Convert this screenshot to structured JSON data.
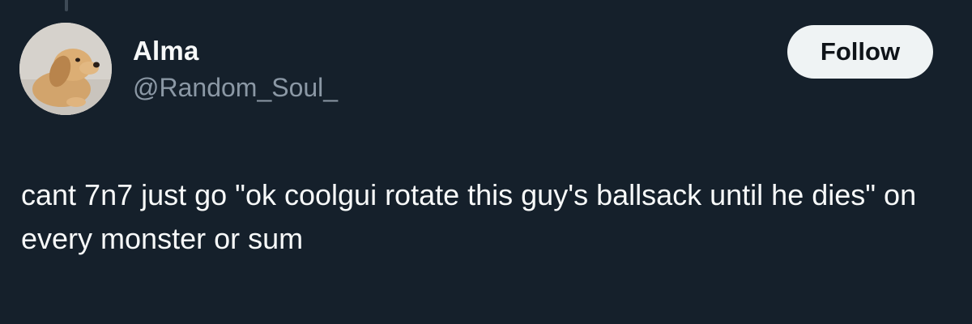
{
  "tweet": {
    "author": {
      "display_name": "Alma",
      "handle": "@Random_Soul_",
      "avatar_icon": "dog-avatar-photo"
    },
    "follow_label": "Follow",
    "text": "cant 7n7 just go \"ok coolgui rotate this guy's ballsack until he dies\" on every monster or sum"
  },
  "colors": {
    "background": "#15202b",
    "primary_text": "#f7f9f9",
    "secondary_text": "#8b98a5",
    "follow_button_bg": "#eff3f4",
    "follow_button_text": "#0f1419"
  }
}
